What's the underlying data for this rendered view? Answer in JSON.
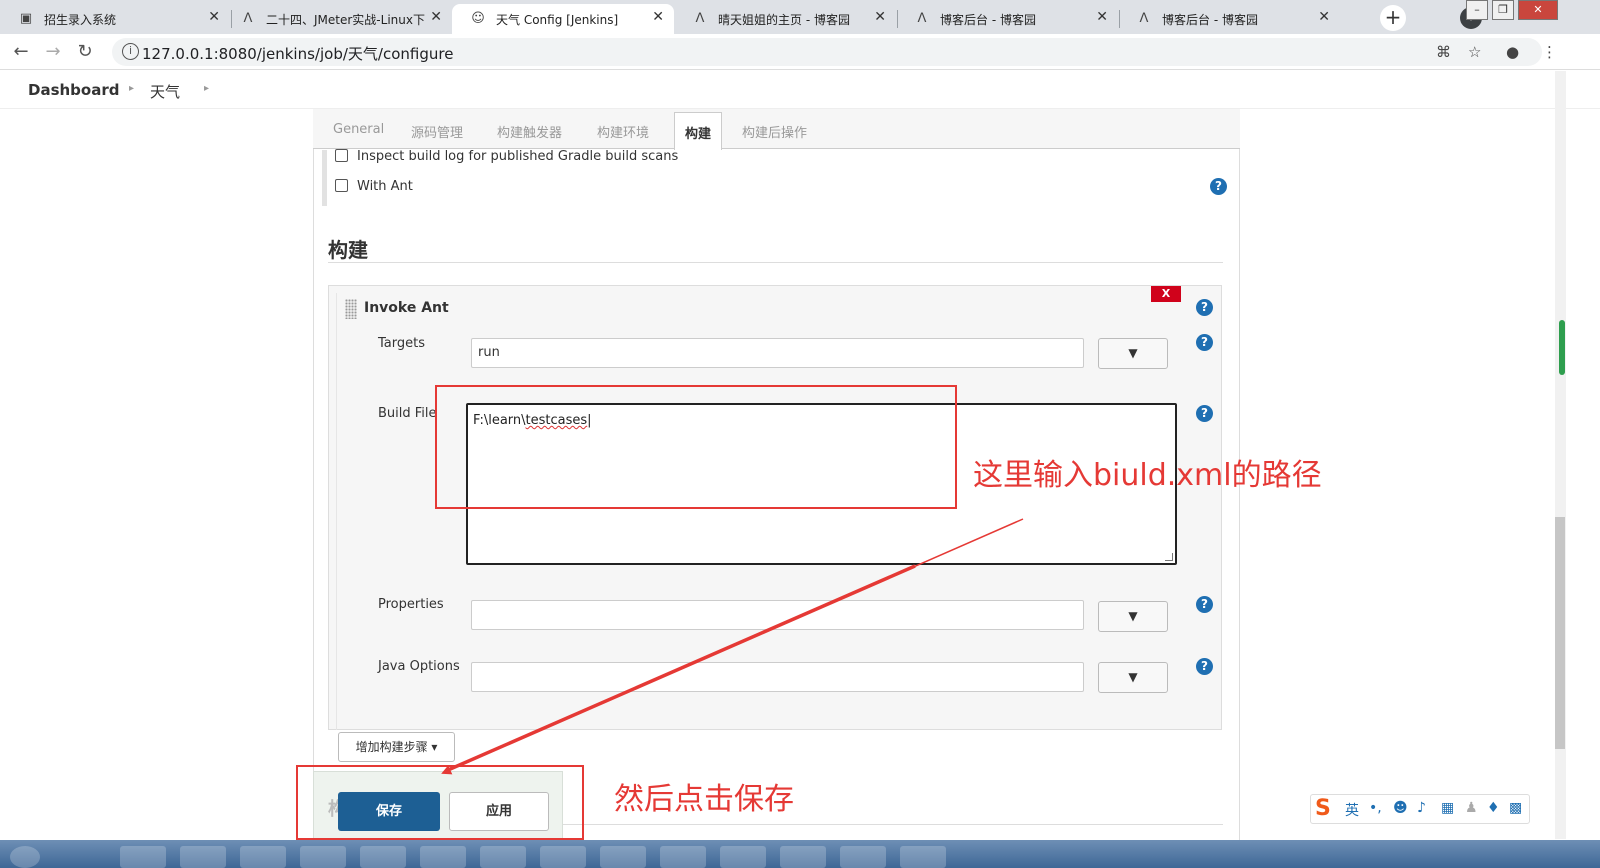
{
  "browser": {
    "tabs": [
      {
        "title": "招生录入系统",
        "icon": "page-icon"
      },
      {
        "title": "二十四、JMeter实战-Linux下",
        "icon": "cnblogs-icon"
      },
      {
        "title": "天气 Config [Jenkins]",
        "icon": "jenkins-icon",
        "active": true
      },
      {
        "title": "晴天姐姐的主页 - 博客园",
        "icon": "cnblogs-icon"
      },
      {
        "title": "博客后台 - 博客园",
        "icon": "cnblogs-icon"
      },
      {
        "title": "博客后台 - 博客园",
        "icon": "cnblogs-icon"
      }
    ],
    "url": "127.0.0.1:8080/jenkins/job/天气/configure"
  },
  "breadcrumb": {
    "dashboard": "Dashboard",
    "job": "天气"
  },
  "config_tabs": [
    "General",
    "源码管理",
    "构建触发器",
    "构建环境",
    "构建",
    "构建后操作"
  ],
  "env_options": {
    "gradle": "Inspect build log for published Gradle build scans",
    "ant": "With Ant"
  },
  "build": {
    "section_title": "构建",
    "step_title": "Invoke Ant",
    "delete_label": "X",
    "targets_label": "Targets",
    "targets_value": "run",
    "buildfile_label": "Build File",
    "buildfile_prefix": "F:\\learn\\",
    "buildfile_suffix": "testcases",
    "properties_label": "Properties",
    "java_options_label": "Java Options",
    "dropdown_glyph": "▼",
    "add_step": "增加构建步骤 ▾"
  },
  "actions": {
    "save": "保存",
    "apply": "应用",
    "ghost": "构"
  },
  "annotations": {
    "path_note": "这里输入biuld.xml的路径",
    "save_note": "然后点击保存",
    "color": "#e53935"
  },
  "ime": {
    "logo": "S",
    "lang": "英"
  }
}
